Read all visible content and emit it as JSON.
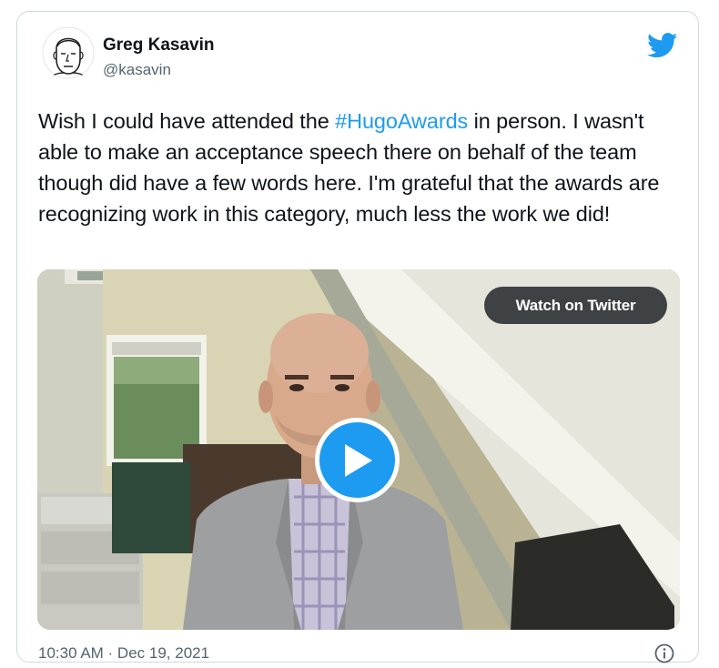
{
  "author": {
    "name": "Greg Kasavin",
    "handle": "@kasavin",
    "avatar_icon": "line-drawing-portrait-avatar"
  },
  "tweet": {
    "text_before": "Wish I could have attended the ",
    "hashtag": "#HugoAwards",
    "text_after": " in person. I wasn't able to make an acceptance speech there on behalf of the team though did have a few words here. I'm grateful that the awards are recognizing work in this category, much less the work we did!"
  },
  "video": {
    "watch_label": "Watch on Twitter",
    "play_icon": "play-icon"
  },
  "footer": {
    "timestamp": "10:30 AM · Dec 19, 2021",
    "info_icon": "info-icon"
  },
  "colors": {
    "accent": "#1d9bf0",
    "text": "#0f1419",
    "secondary_text": "#536471",
    "border": "#cfd9de"
  }
}
